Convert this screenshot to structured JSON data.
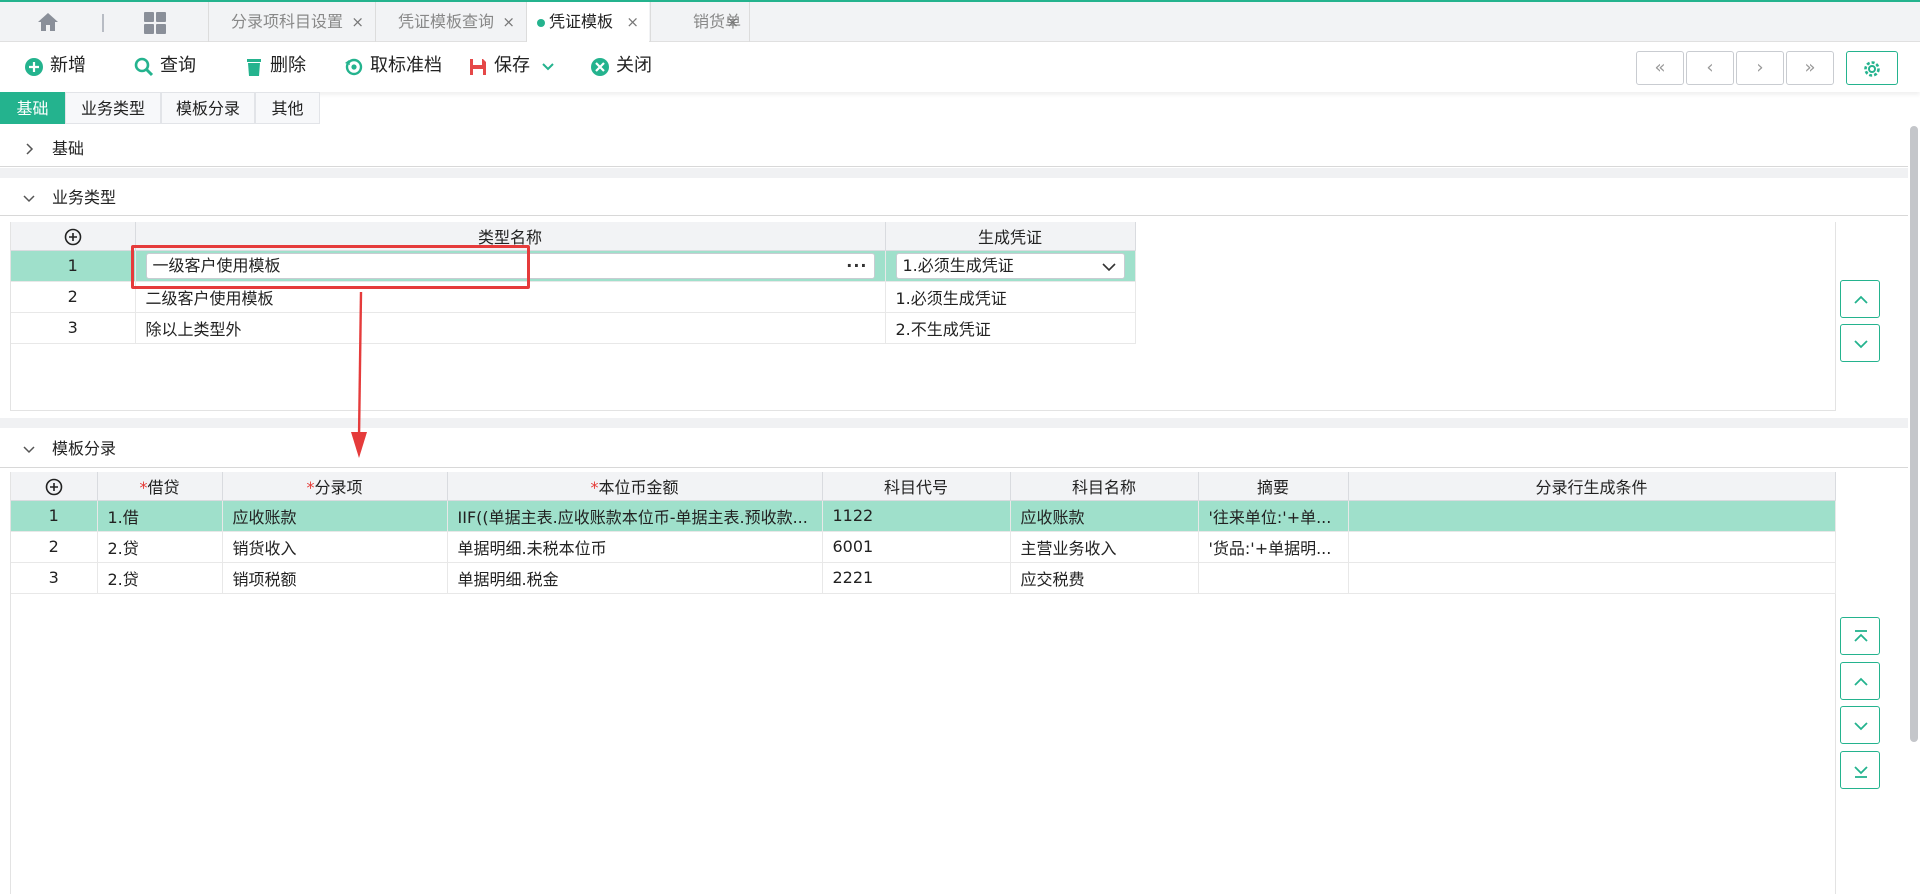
{
  "tabs": [
    {
      "label": "分录项科目设置",
      "active": false
    },
    {
      "label": "凭证模板查询",
      "active": false
    },
    {
      "label": "凭证模板",
      "active": true
    },
    {
      "label": "销货单",
      "active": false
    }
  ],
  "tab_close_glyph": "×",
  "toolbar": {
    "add_label": "新增",
    "query_label": "查询",
    "delete_label": "删除",
    "unbenchmark_label": "取标准档",
    "save_label": "保存",
    "close_label": "关闭"
  },
  "nav": {
    "first": "«",
    "prev": "‹",
    "next": "›",
    "last": "»"
  },
  "subtabs": [
    "基础",
    "业务类型",
    "模板分录",
    "其他"
  ],
  "sections": {
    "basic": "基础",
    "business_type": "业务类型",
    "template_entries": "模板分录"
  },
  "business_grid": {
    "headers": [
      "类型名称",
      "生成凭证"
    ],
    "rows": [
      {
        "num": "1",
        "name": "一级客户使用模板",
        "voucher": "1.必须生成凭证"
      },
      {
        "num": "2",
        "name": "二级客户使用模板",
        "voucher": "1.必须生成凭证"
      },
      {
        "num": "3",
        "name": "除以上类型外",
        "voucher": "2.不生成凭证"
      }
    ],
    "more_glyph": "···"
  },
  "entries_grid": {
    "headers": {
      "debit_credit": "借贷",
      "entry_item": "分录项",
      "amount": "本位币金额",
      "account_code": "科目代号",
      "account_name": "科目名称",
      "summary": "摘要",
      "condition": "分录行生成条件"
    },
    "required_mark": "*",
    "rows": [
      {
        "num": "1",
        "dc": "1.借",
        "item": "应收账款",
        "amount": "IIF((单据主表.应收账款本位币-单据主表.预收款...",
        "code": "1122",
        "name": "应收账款",
        "summary": "'往来单位:'+单...",
        "condition": ""
      },
      {
        "num": "2",
        "dc": "2.贷",
        "item": "销货收入",
        "amount": "单据明细.未税本位币",
        "code": "6001",
        "name": "主营业务收入",
        "summary": "'货品:'+单据明...",
        "condition": ""
      },
      {
        "num": "3",
        "dc": "2.贷",
        "item": "销项税额",
        "amount": "单据明细.税金",
        "code": "2221",
        "name": "应交税费",
        "summary": "",
        "condition": ""
      }
    ]
  },
  "colors": {
    "accent": "#24b38e",
    "selected_row": "#9fe0cb",
    "annotation_red": "#e53b3b"
  }
}
